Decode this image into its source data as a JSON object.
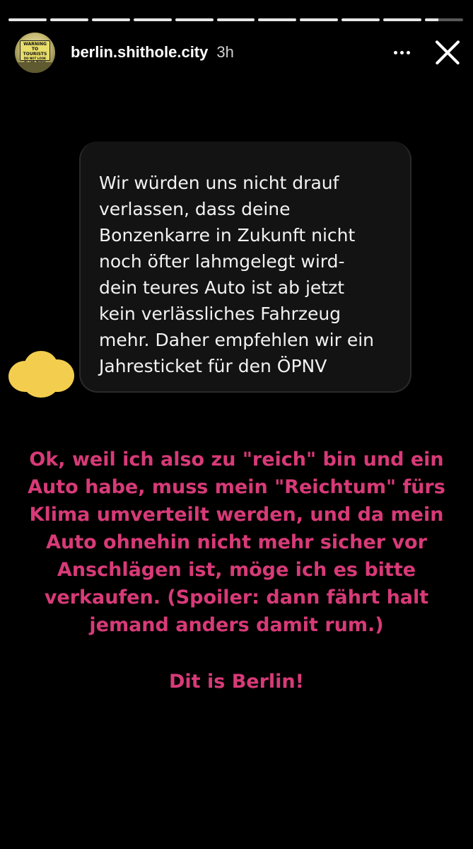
{
  "story": {
    "progress_segments": 11,
    "active_segment_index": 10,
    "active_segment_progress": 0.35
  },
  "header": {
    "avatar_icon": "warning-sign-avatar",
    "avatar_sign_line1": "WARNING",
    "avatar_sign_line2": "TO TOURISTS",
    "avatar_sign_line3": "DO NOT LOOK",
    "avatar_sign_line4": "AT THE NOISE",
    "username": "berlin.shithole.city",
    "time": "3h",
    "more_icon": "more-horizontal-icon",
    "close_icon": "close-icon"
  },
  "message": {
    "text": "Wir würden uns nicht drauf\nverlassen, dass deine\nBonzenkarre in Zukunft nicht\nnoch öfter lahmgelegt wird-\ndein teures Auto ist ab jetzt\nkein verlässliches Fahrzeug\nmehr. Daher empfehlen wir ein\nJahresticket für den ÖPNV",
    "redaction_color": "#f3cd4e"
  },
  "caption": {
    "text": "Ok, weil ich also zu \"reich\" bin und ein\nAuto habe, muss mein \"Reichtum\" fürs\nKlima umverteilt werden, und da mein\nAuto ohnehin nicht mehr sicher vor\nAnschlägen ist, möge ich es bitte\nverkaufen. (Spoiler: dann fährt halt\njemand anders damit rum.)",
    "footer": "Dit is Berlin!",
    "color": "#d83a78"
  }
}
